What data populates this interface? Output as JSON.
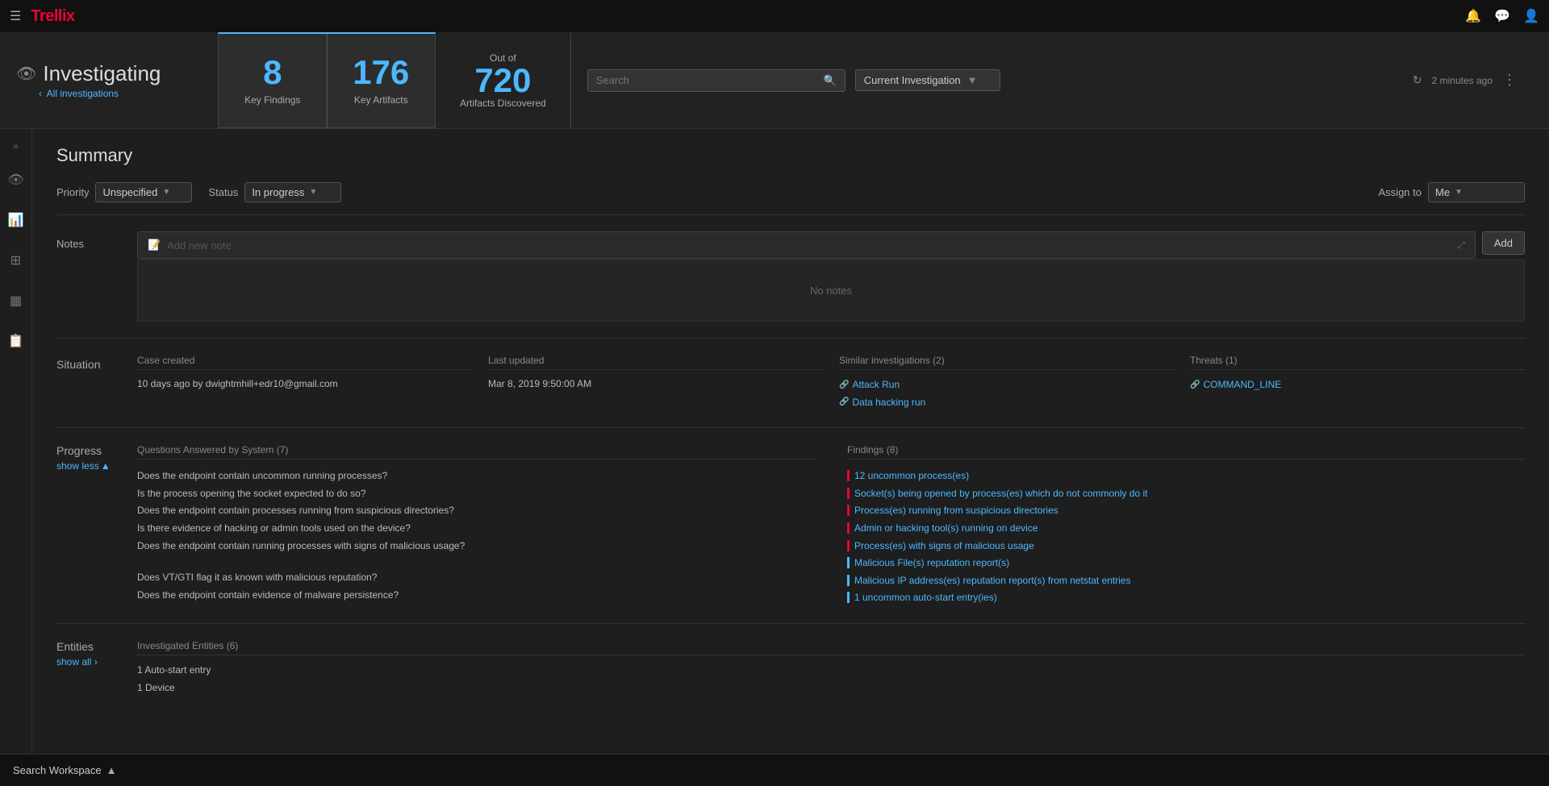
{
  "topNav": {
    "logoText": "Trellix",
    "icons": [
      "bell-icon",
      "chat-icon",
      "user-icon"
    ]
  },
  "header": {
    "eyeIcon": "👁",
    "investigatingLabel": "Investigating",
    "allInvestigationsLabel": "All investigations",
    "keyFindings": {
      "number": "8",
      "label": "Key Findings"
    },
    "keyArtifacts": {
      "number": "176",
      "label": "Key Artifacts"
    },
    "outOf": "Out of",
    "artifactsNumber": "720",
    "artifactsLabel": "Artifacts Discovered",
    "searchPlaceholder": "Search",
    "currentInvestigation": "Current Investigation",
    "lastUpdated": "2 minutes ago"
  },
  "sidebar": {
    "icons": [
      "chevrons-icon",
      "hamburger-icon",
      "chart-icon",
      "grid-icon",
      "layers-icon",
      "book-icon"
    ]
  },
  "summary": {
    "title": "Summary",
    "priority": {
      "label": "Priority",
      "value": "Unspecified"
    },
    "status": {
      "label": "Status",
      "value": "In progress"
    },
    "assignTo": {
      "label": "Assign to",
      "value": "Me"
    },
    "notes": {
      "label": "Notes",
      "placeholder": "Add new note",
      "noNotesText": "No notes",
      "addButton": "Add"
    }
  },
  "situation": {
    "label": "Situation",
    "caseCreated": {
      "header": "Case created",
      "value": "10 days ago by dwightmhill+edr10@gmail.com"
    },
    "lastUpdated": {
      "header": "Last updated",
      "value": "Mar 8, 2019 9:50:00 AM"
    },
    "similarInvestigations": {
      "header": "Similar investigations (2)",
      "links": [
        "Attack Run",
        "Data hacking run"
      ]
    },
    "threats": {
      "header": "Threats (1)",
      "links": [
        "COMMAND_LINE"
      ]
    }
  },
  "progress": {
    "label": "Progress",
    "showLess": "show less",
    "questions": {
      "header": "Questions Answered by System (7)",
      "items": [
        "Does the endpoint contain uncommon running processes?",
        "Is the process opening the socket expected to do so?",
        "Does the endpoint contain processes running from suspicious directories?",
        "Is there evidence of hacking or admin tools used on the device?",
        "Does the endpoint contain running processes with signs of malicious usage?",
        "",
        "Does VT/GTI flag it as known with malicious reputation?",
        "Does the endpoint contain evidence of malware persistence?"
      ]
    },
    "findings": {
      "header": "Findings (8)",
      "items": [
        {
          "text": "12 uncommon process(es)",
          "type": "red"
        },
        {
          "text": "Socket(s) being opened by process(es) which do not commonly do it",
          "type": "red"
        },
        {
          "text": "Process(es) running from suspicious directories",
          "type": "red"
        },
        {
          "text": "Admin or hacking tool(s) running on device",
          "type": "red"
        },
        {
          "text": "Process(es) with signs of malicious usage",
          "type": "red"
        },
        {
          "text": "Malicious File(s) reputation report(s)",
          "type": "blue"
        },
        {
          "text": "Malicious IP address(es) reputation report(s) from netstat entries",
          "type": "blue"
        },
        {
          "text": "1 uncommon auto-start entry(ies)",
          "type": "blue"
        }
      ]
    }
  },
  "entities": {
    "label": "Entities",
    "showAll": "show all ›",
    "investigatedEntities": {
      "header": "Investigated Entities (6)",
      "items": [
        "1 Auto-start entry",
        "1 Device"
      ]
    }
  },
  "bottomBar": {
    "searchWorkspace": "Search Workspace",
    "chevronUp": "▲"
  }
}
